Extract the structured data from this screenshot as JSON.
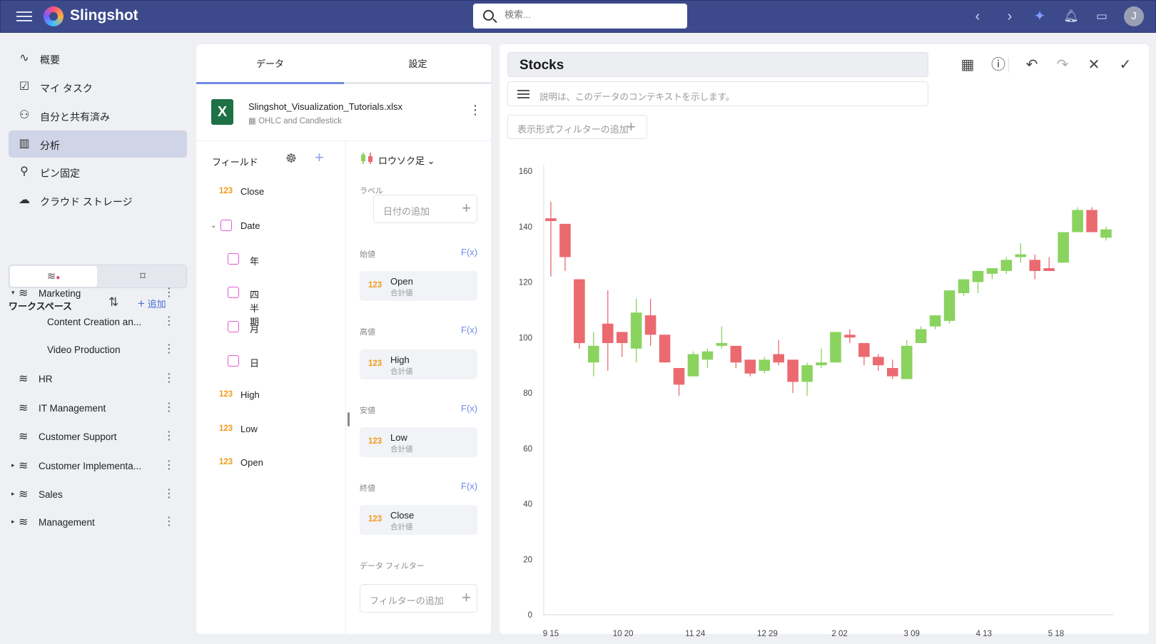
{
  "topbar": {
    "brand": "Slingshot",
    "search_placeholder": "検索...",
    "icons": [
      "menu-icon",
      "back-icon",
      "forward-icon",
      "sparkle-icon",
      "bell-icon",
      "chat-icon"
    ],
    "avatar_initial": "J"
  },
  "nav": {
    "items": [
      {
        "label": "概要",
        "icon": "activity-icon"
      },
      {
        "label": "マイ タスク",
        "icon": "task-icon"
      },
      {
        "label": "自分と共有済み",
        "icon": "shared-user-icon"
      },
      {
        "label": "分析",
        "icon": "chart-icon",
        "active": true
      },
      {
        "label": "ピン固定",
        "icon": "pin-icon"
      },
      {
        "label": "クラウド ストレージ",
        "icon": "cloud-icon"
      }
    ]
  },
  "workspaces": {
    "title": "ワークスペース",
    "add_label": "追加",
    "items": [
      {
        "name": "Marketing",
        "expanded": true
      },
      {
        "name": "Content Creation an...",
        "child": true
      },
      {
        "name": "Video Production",
        "child": true
      },
      {
        "name": "HR"
      },
      {
        "name": "IT Management"
      },
      {
        "name": "Customer Support"
      },
      {
        "name": "Customer Implementa...",
        "collapsed": true
      },
      {
        "name": "Sales",
        "collapsed": true
      },
      {
        "name": "Management",
        "collapsed": true
      }
    ]
  },
  "data_panel": {
    "tabs": [
      "データ",
      "設定"
    ],
    "file": {
      "name": "Slingshot_Visualization_Tutorials.xlsx",
      "sheet": "OHLC and Candlestick"
    },
    "fields_title": "フィールド",
    "fields": [
      {
        "label": "Close",
        "type": "123"
      },
      {
        "label": "Date",
        "type": "date",
        "expanded": true
      },
      {
        "label": "年",
        "type": "date",
        "child": true
      },
      {
        "label": "四半期",
        "type": "date",
        "child": true
      },
      {
        "label": "月",
        "type": "date",
        "child": true
      },
      {
        "label": "日",
        "type": "date",
        "child": true
      },
      {
        "label": "High",
        "type": "123"
      },
      {
        "label": "Low",
        "type": "123"
      },
      {
        "label": "Open",
        "type": "123"
      }
    ],
    "chart_type": "ロウソク足",
    "label_section": "ラベル",
    "label_placeholder": "日付の追加",
    "fx": "F(x)",
    "slots": [
      {
        "section": "始値",
        "field": "Open",
        "agg": "合計値"
      },
      {
        "section": "高値",
        "field": "High",
        "agg": "合計値"
      },
      {
        "section": "安値",
        "field": "Low",
        "agg": "合計値"
      },
      {
        "section": "終値",
        "field": "Close",
        "agg": "合計値"
      }
    ],
    "filter_section": "データ フィルター",
    "filter_placeholder": "フィルターの追加"
  },
  "viz": {
    "title": "Stocks",
    "description_placeholder": "説明は、このデータのコンテキストを示します。",
    "view_filter_placeholder": "表示形式フィルターの追加",
    "toolbar_icons": [
      "table-icon",
      "help-icon",
      "undo-icon",
      "redo-icon",
      "close-icon",
      "check-icon"
    ]
  },
  "chart_data": {
    "type": "candlestick",
    "title": "",
    "ylim": [
      0,
      160
    ],
    "yticks": [
      0,
      20,
      40,
      60,
      80,
      100,
      120,
      140,
      160
    ],
    "xticks": [
      "9 15",
      "10 20",
      "11 24",
      "12 29",
      "2 02",
      "3 09",
      "4 13",
      "5 18"
    ],
    "grid": false,
    "colors": {
      "up": "#8ad35f",
      "down": "#eb6a70"
    },
    "candles": [
      {
        "o": 143,
        "h": 149,
        "l": 122,
        "c": 142
      },
      {
        "o": 141,
        "h": 141,
        "l": 124,
        "c": 129
      },
      {
        "o": 121,
        "h": 121,
        "l": 96,
        "c": 98
      },
      {
        "o": 91,
        "h": 102,
        "l": 86,
        "c": 97
      },
      {
        "o": 105,
        "h": 117,
        "l": 88,
        "c": 98
      },
      {
        "o": 102,
        "h": 102,
        "l": 93,
        "c": 98
      },
      {
        "o": 96,
        "h": 114,
        "l": 91,
        "c": 109
      },
      {
        "o": 108,
        "h": 114,
        "l": 97,
        "c": 101
      },
      {
        "o": 101,
        "h": 101,
        "l": 91,
        "c": 91
      },
      {
        "o": 89,
        "h": 89,
        "l": 79,
        "c": 83
      },
      {
        "o": 86,
        "h": 95,
        "l": 86,
        "c": 94
      },
      {
        "o": 92,
        "h": 96,
        "l": 89,
        "c": 95
      },
      {
        "o": 97,
        "h": 104,
        "l": 96,
        "c": 98
      },
      {
        "o": 97,
        "h": 97,
        "l": 89,
        "c": 91
      },
      {
        "o": 92,
        "h": 92,
        "l": 86,
        "c": 87
      },
      {
        "o": 88,
        "h": 93,
        "l": 87,
        "c": 92
      },
      {
        "o": 94,
        "h": 99,
        "l": 90,
        "c": 91
      },
      {
        "o": 92,
        "h": 92,
        "l": 80,
        "c": 84
      },
      {
        "o": 84,
        "h": 91,
        "l": 79,
        "c": 90
      },
      {
        "o": 90,
        "h": 96,
        "l": 89,
        "c": 91
      },
      {
        "o": 91,
        "h": 102,
        "l": 91,
        "c": 102
      },
      {
        "o": 101,
        "h": 103,
        "l": 98,
        "c": 100
      },
      {
        "o": 98,
        "h": 98,
        "l": 90,
        "c": 93
      },
      {
        "o": 93,
        "h": 94,
        "l": 88,
        "c": 90
      },
      {
        "o": 89,
        "h": 92,
        "l": 85,
        "c": 86
      },
      {
        "o": 85,
        "h": 99,
        "l": 85,
        "c": 97
      },
      {
        "o": 98,
        "h": 104,
        "l": 98,
        "c": 103
      },
      {
        "o": 104,
        "h": 107,
        "l": 103,
        "c": 108
      },
      {
        "o": 106,
        "h": 117,
        "l": 105,
        "c": 117
      },
      {
        "o": 116,
        "h": 121,
        "l": 115,
        "c": 121
      },
      {
        "o": 120,
        "h": 124,
        "l": 116,
        "c": 124
      },
      {
        "o": 123,
        "h": 125,
        "l": 121,
        "c": 125
      },
      {
        "o": 124,
        "h": 129,
        "l": 123,
        "c": 128
      },
      {
        "o": 129,
        "h": 134,
        "l": 127,
        "c": 130
      },
      {
        "o": 128,
        "h": 130,
        "l": 121,
        "c": 124
      },
      {
        "o": 125,
        "h": 129,
        "l": 124,
        "c": 124
      },
      {
        "o": 127,
        "h": 138,
        "l": 127,
        "c": 138
      },
      {
        "o": 138,
        "h": 147,
        "l": 138,
        "c": 146
      },
      {
        "o": 146,
        "h": 147,
        "l": 138,
        "c": 138
      },
      {
        "o": 136,
        "h": 140,
        "l": 135,
        "c": 139
      }
    ]
  }
}
